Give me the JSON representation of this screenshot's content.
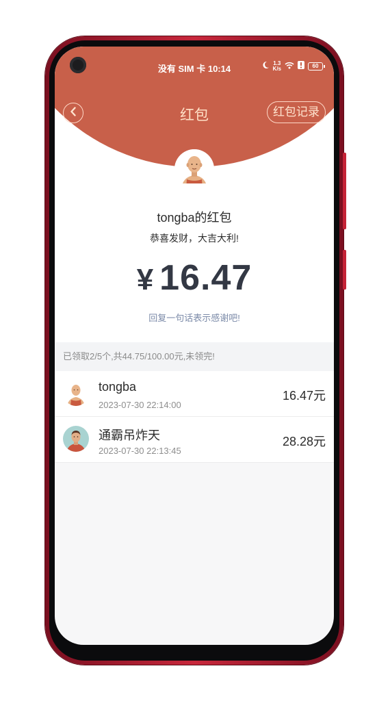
{
  "status_bar": {
    "carrier_time": "没有 SIM 卡 10:14",
    "network_speed_value": "1.3",
    "network_speed_unit": "K/s",
    "battery_level": "60"
  },
  "header": {
    "back_icon": "chevron-left-icon",
    "title": "红包",
    "record_label": "红包记录"
  },
  "envelope": {
    "sender_name": "tongba的红包",
    "greeting": "恭喜发财，大吉大利!",
    "currency": "¥",
    "amount": "16.47",
    "reply_hint": "回复一句话表示感谢吧!"
  },
  "summary": "已领取2/5个,共44.75/100.00元,未领完!",
  "receivers": [
    {
      "name": "tongba",
      "time": "2023-07-30 22:14:00",
      "amount": "16.47元"
    },
    {
      "name": "通霸吊炸天",
      "time": "2023-07-30 22:13:45",
      "amount": "28.28元"
    }
  ],
  "colors": {
    "header_red": "#c8604a",
    "accent_text": "#ffe0c6",
    "amount_text": "#333844",
    "reply_text": "#7b8aa8"
  }
}
